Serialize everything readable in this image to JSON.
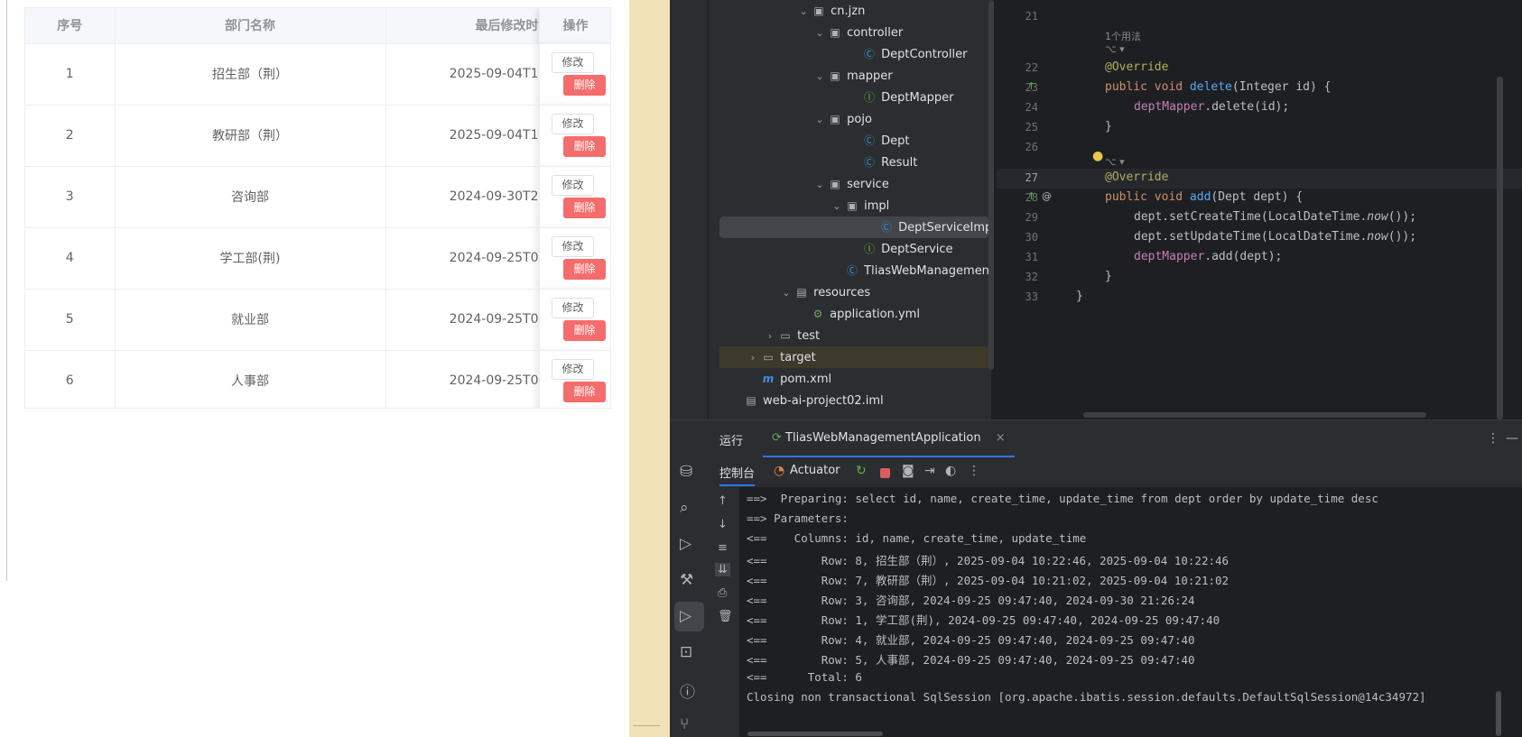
{
  "web": {
    "table": {
      "headers": [
        "序号",
        "部门名称",
        "最后修改时",
        "操作"
      ],
      "rows": [
        {
          "no": "1",
          "name": "招生部（荆）",
          "time": "2025-09-04T1"
        },
        {
          "no": "2",
          "name": "教研部（荆）",
          "time": "2025-09-04T1"
        },
        {
          "no": "3",
          "name": "咨询部",
          "time": "2024-09-30T2"
        },
        {
          "no": "4",
          "name": "学工部(荆)",
          "time": "2024-09-25T0"
        },
        {
          "no": "5",
          "name": "就业部",
          "time": "2024-09-25T0"
        },
        {
          "no": "6",
          "name": "人事部",
          "time": "2024-09-25T0"
        }
      ],
      "edit_label": "修改",
      "delete_label": "删除"
    }
  },
  "project_tree": [
    {
      "label": "cn.jzn",
      "icon": "package-folder-icon"
    },
    {
      "label": "controller",
      "icon": "package-folder-icon"
    },
    {
      "label": "DeptController",
      "icon": "class-icon"
    },
    {
      "label": "mapper",
      "icon": "package-folder-icon"
    },
    {
      "label": "DeptMapper",
      "icon": "interface-icon"
    },
    {
      "label": "pojo",
      "icon": "package-folder-icon"
    },
    {
      "label": "Dept",
      "icon": "class-icon"
    },
    {
      "label": "Result",
      "icon": "class-icon"
    },
    {
      "label": "service",
      "icon": "package-folder-icon"
    },
    {
      "label": "impl",
      "icon": "package-folder-icon"
    },
    {
      "label": "DeptServiceImpl",
      "icon": "class-icon"
    },
    {
      "label": "DeptService",
      "icon": "interface-icon"
    },
    {
      "label": "TliasWebManagementAp",
      "icon": "app-class-icon"
    },
    {
      "label": "resources",
      "icon": "resources-folder-icon"
    },
    {
      "label": "application.yml",
      "icon": "yml-file-icon"
    },
    {
      "label": "test",
      "icon": "folder-icon"
    },
    {
      "label": "target",
      "icon": "folder-icon"
    },
    {
      "label": "pom.xml",
      "icon": "maven-icon"
    },
    {
      "label": "web-ai-project02.iml",
      "icon": "iml-file-icon"
    }
  ],
  "editor": {
    "line_numbers": [
      "21",
      "22",
      "23",
      "24",
      "25",
      "26",
      "27",
      "28",
      "29",
      "30",
      "31",
      "32",
      "33"
    ],
    "usage_hint": "1个用法",
    "override": "@Override",
    "delete_sig_kw": "public void ",
    "delete_name": "delete",
    "delete_params": "(Integer id) {",
    "delete_body_field": "deptMapper",
    "delete_body_rest": ".delete(id);",
    "close_brace": "}",
    "add_sig_kw": "public void ",
    "add_name": "add",
    "add_params": "(Dept dept) {",
    "set_create": "dept.setCreateTime(LocalDateTime.",
    "set_update": "dept.setUpdateTime(LocalDateTime.",
    "now_call": "now",
    "now_tail": "());",
    "add_body_field": "deptMapper",
    "add_body_rest": ".add(dept);",
    "class_close": "}"
  },
  "run": {
    "label": "运行",
    "tab": "TliasWebManagementApplication",
    "console_tab": "控制台",
    "actuator_tab": "Actuator",
    "console_lines": [
      "==>  Preparing: select id, name, create_time, update_time from dept order by update_time desc",
      "==> Parameters: ",
      "<==    Columns: id, name, create_time, update_time",
      "<==        Row: 8, 招生部（荆）, 2025-09-04 10:22:46, 2025-09-04 10:22:46",
      "<==        Row: 7, 教研部（荆）, 2025-09-04 10:21:02, 2025-09-04 10:21:02",
      "<==        Row: 3, 咨询部, 2024-09-25 09:47:40, 2024-09-30 21:26:24",
      "<==        Row: 1, 学工部(荆), 2024-09-25 09:47:40, 2024-09-25 09:47:40",
      "<==        Row: 4, 就业部, 2024-09-25 09:47:40, 2024-09-25 09:47:40",
      "<==        Row: 5, 人事部, 2024-09-25 09:47:40, 2024-09-25 09:47:40",
      "<==      Total: 6",
      "Closing non transactional SqlSession [org.apache.ibatis.session.defaults.DefaultSqlSession@14c34972]"
    ]
  },
  "colors": {
    "delete_button": "#f56c6c",
    "ide_bg": "#1e1f22",
    "panel_bg": "#2b2d30",
    "accent_blue": "#3574f0",
    "divider_strip": "#f2e2b8"
  }
}
